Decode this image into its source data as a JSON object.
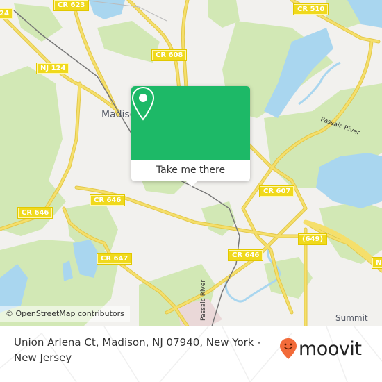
{
  "map": {
    "colors": {
      "land": "#f2f1ee",
      "park": "#d2e8b5",
      "water": "#a9d6ef",
      "road": "#f5df6b",
      "road_casing": "#e3c84a",
      "rail": "#777777",
      "accent": "#1db967",
      "brand_pin": "#f26b3a"
    },
    "road_labels": [
      "CR 623",
      "CR 510",
      "NJ 124",
      "24",
      "CR 608",
      "CR 607",
      "CR 646",
      "CR 646",
      "CR 646",
      "CR 647",
      "(649)",
      "N"
    ],
    "place_labels": [
      "Madison",
      "Summit"
    ],
    "river_labels": [
      "Passaic River",
      "Passaic River"
    ],
    "attribution": "© OpenStreetMap contributors"
  },
  "popup": {
    "icon": "location-pin-icon",
    "button_label": "Take me there"
  },
  "footer": {
    "address": "Union Arlena Ct, Madison, NJ 07940, New York - New Jersey",
    "brand": "moovit",
    "brand_icon": "moovit-smiley-pin-icon"
  }
}
